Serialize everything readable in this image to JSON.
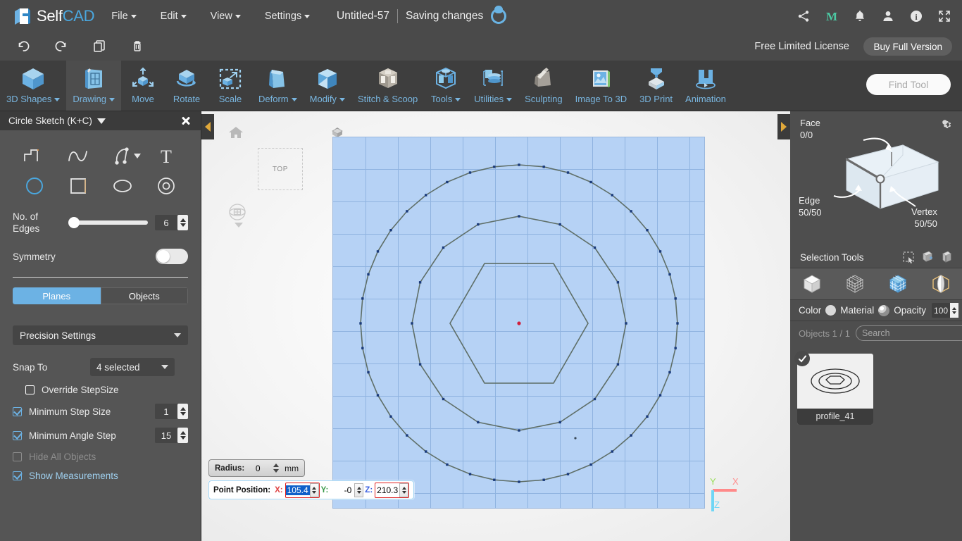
{
  "app": {
    "brand_main": "Self",
    "brand_accent": "CAD",
    "accent_color": "#4aa8e0",
    "panel_bg": "#555555",
    "ribbon_bg": "#3e3e3e"
  },
  "menubar": {
    "items": [
      {
        "label": "File",
        "has_caret": true
      },
      {
        "label": "Edit",
        "has_caret": true
      },
      {
        "label": "View",
        "has_caret": true
      },
      {
        "label": "Settings",
        "has_caret": true
      }
    ]
  },
  "document": {
    "title": "Untitled-57",
    "status": "Saving changes"
  },
  "top_icons": [
    {
      "name": "share-icon"
    },
    {
      "name": "manifold-m-icon"
    },
    {
      "name": "notifications-bell-icon"
    },
    {
      "name": "user-account-icon"
    },
    {
      "name": "info-icon"
    },
    {
      "name": "fullscreen-icon"
    }
  ],
  "license": {
    "text": "Free Limited License",
    "buy_label": "Buy Full Version"
  },
  "quick_actions": [
    {
      "name": "undo-button"
    },
    {
      "name": "redo-button"
    },
    {
      "name": "copy-button"
    },
    {
      "name": "delete-button"
    }
  ],
  "ribbon": {
    "items": [
      {
        "label": "3D Shapes",
        "caret": true,
        "active": false
      },
      {
        "label": "Drawing",
        "caret": true,
        "active": true
      },
      {
        "label": "Move",
        "caret": false,
        "active": false
      },
      {
        "label": "Rotate",
        "caret": false,
        "active": false
      },
      {
        "label": "Scale",
        "caret": false,
        "active": false
      },
      {
        "label": "Deform",
        "caret": true,
        "active": false
      },
      {
        "label": "Modify",
        "caret": true,
        "active": false
      },
      {
        "label": "Stitch & Scoop",
        "caret": false,
        "active": false
      },
      {
        "label": "Tools",
        "caret": true,
        "active": false
      },
      {
        "label": "Utilities",
        "caret": true,
        "active": false
      },
      {
        "label": "Sculpting",
        "caret": false,
        "active": false
      },
      {
        "label": "Image To 3D",
        "caret": false,
        "active": false
      },
      {
        "label": "3D Print",
        "caret": false,
        "active": false
      },
      {
        "label": "Animation",
        "caret": false,
        "active": false
      }
    ],
    "find_tool_placeholder": "Find Tool",
    "find_tool_value": ""
  },
  "left_panel": {
    "title": "Circle Sketch (K+C)",
    "tools": [
      {
        "name": "polyline-sketch-tool",
        "active": false
      },
      {
        "name": "spline-sketch-tool",
        "active": false
      },
      {
        "name": "freehand-sketch-tool",
        "active": false,
        "has_caret": true
      },
      {
        "name": "text-sketch-tool",
        "active": false
      },
      {
        "name": "circle-sketch-tool",
        "active": true
      },
      {
        "name": "rectangle-sketch-tool",
        "active": false
      },
      {
        "name": "ellipse-sketch-tool",
        "active": false
      },
      {
        "name": "ring-sketch-tool",
        "active": false
      }
    ],
    "edges": {
      "label": "No. of Edges",
      "value": "6",
      "slider_percent": 4
    },
    "symmetry": {
      "label": "Symmetry",
      "on": false
    },
    "target_tabs": [
      {
        "label": "Planes",
        "selected": true
      },
      {
        "label": "Objects",
        "selected": false
      }
    ],
    "precision_settings": {
      "label": "Precision Settings"
    },
    "snap_to": {
      "label": "Snap To",
      "value": "4 selected"
    },
    "checkboxes": [
      {
        "label": "Override StepSize",
        "checked": false,
        "disabled": false,
        "value": null
      },
      {
        "label": "Minimum Step Size",
        "checked": true,
        "disabled": false,
        "value": "1"
      },
      {
        "label": "Minimum Angle Step",
        "checked": true,
        "disabled": false,
        "value": "15"
      },
      {
        "label": "Hide All Objects",
        "checked": false,
        "disabled": true,
        "value": null
      },
      {
        "label": "Show Measurements",
        "checked": true,
        "disabled": false,
        "value": null
      }
    ]
  },
  "viewport": {
    "view_cube_label": "TOP",
    "home_icon": "home-icon",
    "nav_widget": "orbit-navigation-icon",
    "grid_color": "#b6d2f5",
    "measurements": {
      "radius": {
        "label": "Radius:",
        "value": "0",
        "unit": "mm"
      },
      "point_position": {
        "label": "Point Position:",
        "x_label": "X:",
        "x_value": "105.4",
        "y_label": "Y:",
        "y_value": "-0",
        "z_label": "Z:",
        "z_value": "210.3"
      }
    },
    "axis_gizmo": {
      "x": "X",
      "y": "Y",
      "z": "Z",
      "x_color": "#ff8a8a",
      "y_color": "#9ade5a",
      "z_color": "#6fd6f5"
    }
  },
  "right_panel": {
    "selection_info": {
      "face_label": "Face",
      "face_value": "0/0",
      "edge_label": "Edge",
      "edge_value": "50/50",
      "vertex_label": "Vertex",
      "vertex_value": "50/50",
      "gear": "settings-gear-icon"
    },
    "selection_tools": {
      "title": "Selection Tools",
      "icons": [
        {
          "name": "rectangle-select-icon"
        },
        {
          "name": "select-through-icon"
        },
        {
          "name": "select-loop-icon"
        }
      ]
    },
    "selection_modes": [
      {
        "name": "object-mode-icon",
        "active": false
      },
      {
        "name": "vertex-mode-icon",
        "active": false
      },
      {
        "name": "face-mode-icon",
        "active": true
      },
      {
        "name": "edge-mode-icon",
        "active": false
      }
    ],
    "appearance": {
      "color_label": "Color",
      "material_label": "Material",
      "opacity_label": "Opacity",
      "opacity_value": "100"
    },
    "objects": {
      "count_label": "Objects 1 / 1",
      "search_placeholder": "Search",
      "search_value": "",
      "gear": "objects-settings-gear-icon",
      "items": [
        {
          "name": "profile_41",
          "selected": true
        }
      ]
    }
  }
}
